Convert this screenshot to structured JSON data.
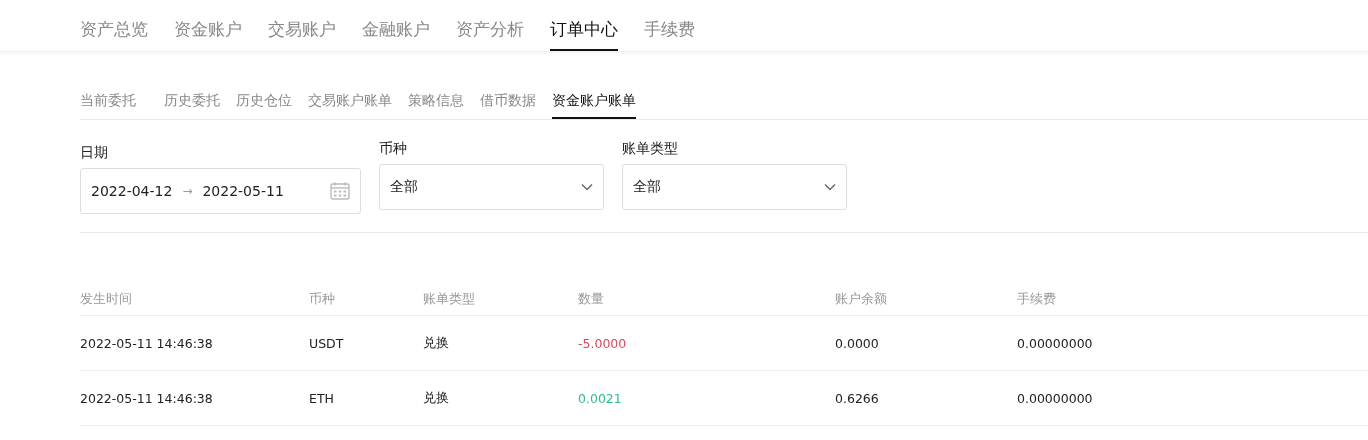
{
  "main_tabs": [
    {
      "label": "资产总览",
      "selected": false
    },
    {
      "label": "资金账户",
      "selected": false
    },
    {
      "label": "交易账户",
      "selected": false
    },
    {
      "label": "金融账户",
      "selected": false
    },
    {
      "label": "资产分析",
      "selected": false
    },
    {
      "label": "订单中心",
      "selected": true
    },
    {
      "label": "手续费",
      "selected": false
    }
  ],
  "sub_tabs": [
    {
      "label": "当前委托",
      "selected": false
    },
    {
      "label": "历史委托",
      "selected": false
    },
    {
      "label": "历史仓位",
      "selected": false
    },
    {
      "label": "交易账户账单",
      "selected": false
    },
    {
      "label": "策略信息",
      "selected": false
    },
    {
      "label": "借币数据",
      "selected": false
    },
    {
      "label": "资金账户账单",
      "selected": true
    }
  ],
  "filters": {
    "date": {
      "label": "日期",
      "start": "2022-04-12",
      "arrow": "→",
      "end": "2022-05-11"
    },
    "currency": {
      "label": "币种",
      "value": "全部"
    },
    "bill_type": {
      "label": "账单类型",
      "value": "全部"
    }
  },
  "table": {
    "columns": [
      "发生时间",
      "币种",
      "账单类型",
      "数量",
      "账户余额",
      "手续费"
    ],
    "rows": [
      {
        "cells": [
          "2022-05-11 14:46:38",
          "USDT",
          "兑换",
          "-5.0000",
          "0.0000",
          "0.00000000"
        ],
        "color": "#d9485f"
      },
      {
        "cells": [
          "2022-05-11 14:46:38",
          "ETH",
          "兑换",
          "0.0021",
          "0.6266",
          "0.00000000"
        ],
        "color": "#2dbd85"
      }
    ]
  }
}
